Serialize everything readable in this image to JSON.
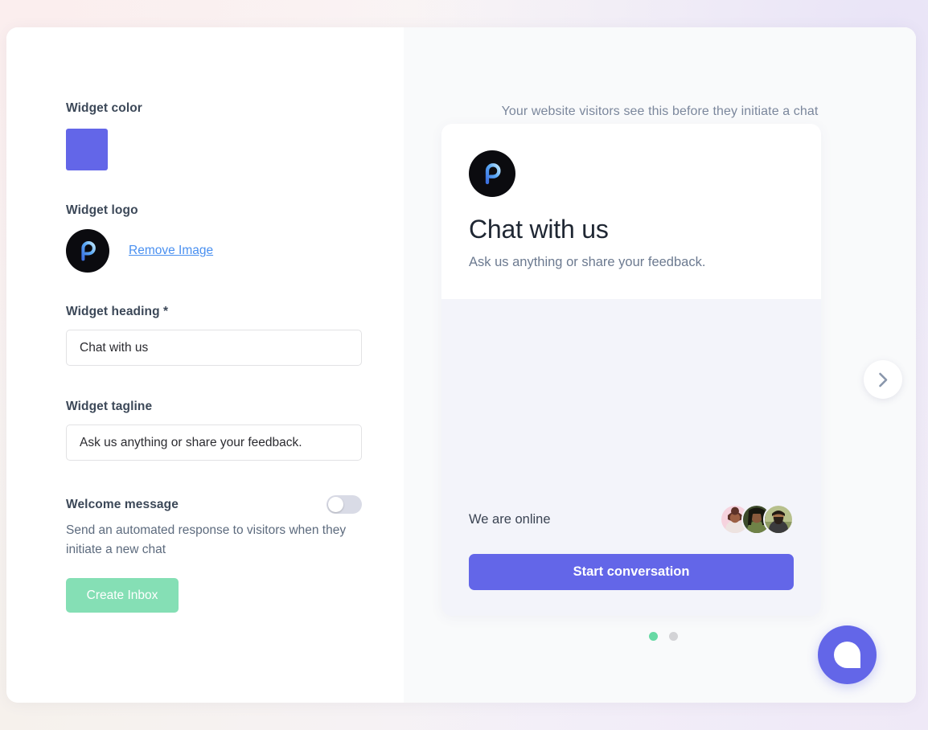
{
  "colors": {
    "widget_purple": "#6366e8",
    "create_btn_green": "#85dfb5",
    "dot_active_green": "#67d9a4",
    "dot_inactive_gray": "#d3d3d6",
    "logo_bg_black": "#0b0b0f",
    "toggle_track_gray": "#d9dbe6"
  },
  "form": {
    "widget_color": {
      "label": "Widget color",
      "value": "#6366e8"
    },
    "widget_logo": {
      "label": "Widget logo",
      "remove_label": "Remove Image"
    },
    "widget_heading": {
      "label": "Widget heading *",
      "value": "Chat with us",
      "placeholder": "Chat with us"
    },
    "widget_tagline": {
      "label": "Widget tagline",
      "value": "Ask us anything or share your feedback.",
      "placeholder": "Ask us anything or share your feedback."
    },
    "welcome_message": {
      "label": "Welcome message",
      "toggle_state": "off",
      "description": "Send an automated response to visitors when they initiate a new chat"
    },
    "submit_label": "Create Inbox"
  },
  "preview": {
    "caption": "Your website visitors see this before they initiate a chat",
    "widget": {
      "title": "Chat with us",
      "tagline": "Ask us anything or share your feedback.",
      "online_status": "We are online",
      "start_label": "Start conversation"
    },
    "carousel": {
      "dots": [
        "active",
        "inactive"
      ]
    }
  }
}
